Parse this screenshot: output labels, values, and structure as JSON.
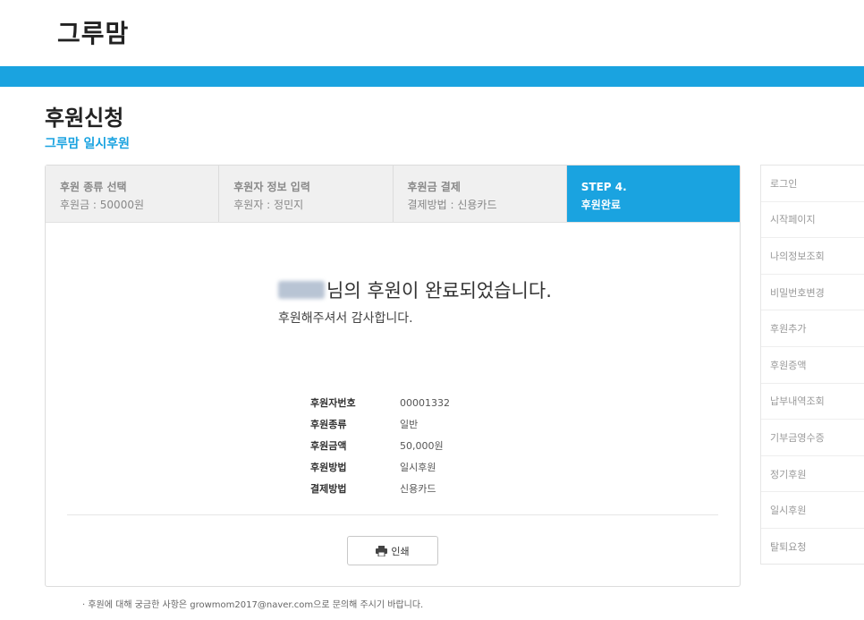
{
  "header": {
    "logo_text": "그루맘",
    "bar_color": "#1aa3e0"
  },
  "page": {
    "title": "후원신청",
    "subtitle": "그루맘 일시후원"
  },
  "steps": [
    {
      "title": "후원 종류 선택",
      "sub": "후원금 : 50000원"
    },
    {
      "title": "후원자 정보 입력",
      "sub": "후원자 : 정민지"
    },
    {
      "title": "후원금 결제",
      "sub": "결제방법 : 신용카드"
    },
    {
      "title": "STEP 4.",
      "sub": "후원완료",
      "active": true
    }
  ],
  "completion": {
    "name_suffix": "님의 후원이 완료되었습니다.",
    "thanks": "후원해주셔서 감사합니다."
  },
  "details": [
    {
      "label": "후원자번호",
      "value": "00001332"
    },
    {
      "label": "후원종류",
      "value": "일반"
    },
    {
      "label": "후원금액",
      "value": "50,000원"
    },
    {
      "label": "후원방법",
      "value": "일시후원"
    },
    {
      "label": "결제방법",
      "value": "신용카드"
    }
  ],
  "print_button": {
    "label": "인쇄",
    "icon": "printer-icon"
  },
  "sidebar": {
    "items": [
      "로그인",
      "시작페이지",
      "나의정보조회",
      "비밀번호변경",
      "후원추가",
      "후원증액",
      "납부내역조회",
      "기부금영수증",
      "정기후원",
      "일시후원",
      "탈퇴요청"
    ]
  },
  "footer": {
    "note": "· 후원에 대해 궁금한 사항은 growmom2017@naver.com으로 문의해 주시기 바랍니다."
  }
}
